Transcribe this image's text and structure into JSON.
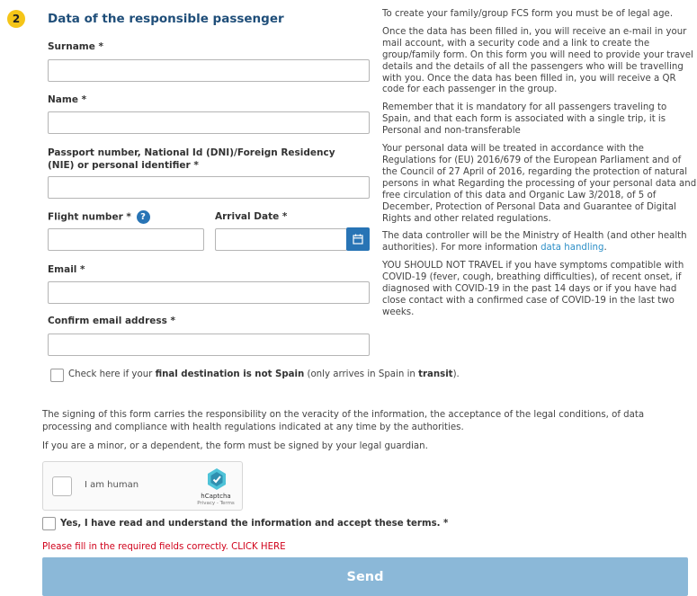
{
  "step": {
    "number": "2",
    "title": "Data of the responsible passenger"
  },
  "form": {
    "surname_label": "Surname *",
    "name_label": "Name *",
    "passport_label": "Passport number, National Id (DNI)/Foreign Residency (NIE) or personal identifier *",
    "flight_label": "Flight number *",
    "flight_help": "?",
    "arrival_label": "Arrival Date *",
    "email_label": "Email *",
    "confirm_email_label": "Confirm email address *",
    "surname_value": "",
    "name_value": "",
    "passport_value": "",
    "flight_value": "",
    "arrival_value": "",
    "email_value": "",
    "confirm_email_value": ""
  },
  "transit": {
    "prefix": "Check here if your ",
    "bold": "final destination is not Spain",
    "middle": " (only arrives in Spain in ",
    "bold2": "transit",
    "suffix": ")."
  },
  "info": {
    "p1": "To create your family/group FCS form you must be of legal age.",
    "p2": "Once the data has been filled in, you will receive an e-mail in your mail account, with a security code and a link to create the group/family form. On this form you will need to provide your travel details and the details of all the passengers who will be travelling with you. Once the data has been filled in, you will receive a QR code for each passenger in the group.",
    "p3": "Remember that it is mandatory for all passengers traveling to Spain, and that each form is associated with a single trip, it is Personal and non-transferable",
    "p4": "Your personal data will be treated in accordance with the Regulations for (EU) 2016/679 of the European Parliament and of the Council of 27 April of 2016, regarding the protection of natural persons in what Regarding the processing of your personal data and free circulation of this data and Organic Law 3/2018, of 5 of December, Protection of Personal Data and Guarantee of Digital Rights and other related regulations.",
    "p5_prefix": "The data controller will be the Ministry of Health (and other health authorities). For more information ",
    "p5_link": "data handling",
    "p5_suffix": ".",
    "p6": "YOU SHOULD NOT TRAVEL if you have symptoms compatible with COVID-19 (fever, cough, breathing difficulties), of recent onset, if diagnosed with COVID-19 in the past 14 days or if you have had close contact with a confirmed case of COVID-19 in the last two weeks."
  },
  "legal": {
    "p1": "The signing of this form carries the responsibility on the veracity of the information, the acceptance of the legal conditions, of data processing and compliance with health regulations indicated at any time by the authorities.",
    "p2": "If you are a minor, or a dependent, the form must be signed by your legal guardian."
  },
  "captcha": {
    "label": "I am human",
    "brand": "hCaptcha",
    "links": "Privacy - Terms"
  },
  "terms": {
    "label": "Yes, I have read and understand the information and accept these terms. *"
  },
  "error": {
    "message": "Please fill in the required fields correctly. CLICK HERE"
  },
  "submit": {
    "label": "Send"
  },
  "colors": {
    "accent": "#2874b5",
    "title": "#1f4e79",
    "badge": "#f5c518",
    "error": "#d0021b",
    "send": "#8bb8d8"
  }
}
